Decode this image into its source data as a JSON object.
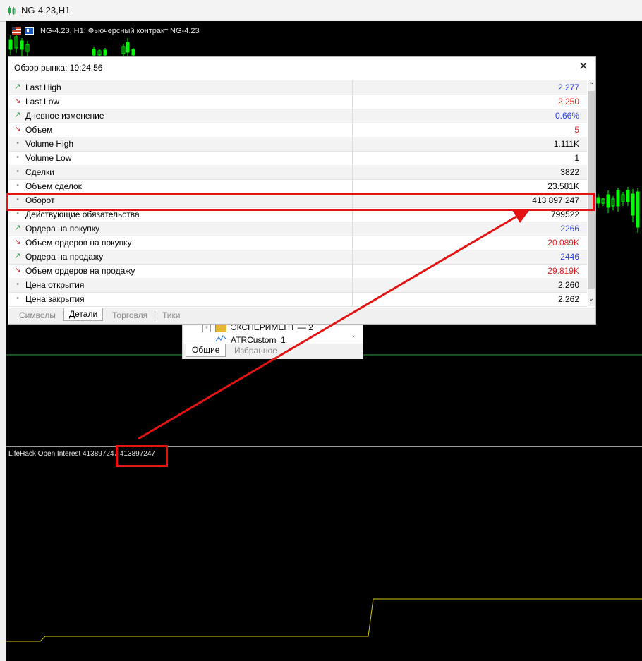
{
  "window": {
    "title": "NG-4.23,H1"
  },
  "chart": {
    "title": "NG-4.23, H1:  Фьючерсный контракт NG-4.23",
    "indicator_label": "LifeHack Open Interest  413897247 413897247",
    "colors": {
      "background": "#000000",
      "bull": "#00ff00",
      "level_line": "#2ea043",
      "indicator_line": "#d4c817",
      "highlight": "#e41313"
    }
  },
  "navigator": {
    "rows": [
      {
        "label": "ЭКСПЕРИМЕНТ — 2",
        "icon": "folder-icon"
      },
      {
        "label": "ATRCustom_1",
        "icon": "indicator-icon"
      }
    ],
    "tabs": [
      "Общие",
      "Избранное"
    ]
  },
  "market_watch": {
    "title": "Обзор рынка: 19:24:56",
    "close_label": "✕",
    "rows": [
      {
        "icon": "arrow-up-icon",
        "label": "Last High",
        "value": "2.277",
        "color": "#2b3ee0"
      },
      {
        "icon": "arrow-down-icon",
        "label": "Last Low",
        "value": "2.250",
        "color": "#e02020"
      },
      {
        "icon": "arrow-up-icon",
        "label": "Дневное изменение",
        "value": "0.66%",
        "color": "#2b3ee0"
      },
      {
        "icon": "arrow-down-icon",
        "label": "Объем",
        "value": "5",
        "color": "#e02020"
      },
      {
        "icon": "dot-icon",
        "label": "Volume High",
        "value": "1.111K",
        "color": "#000000"
      },
      {
        "icon": "dot-icon",
        "label": "Volume Low",
        "value": "1",
        "color": "#000000"
      },
      {
        "icon": "dot-icon",
        "label": "Сделки",
        "value": "3822",
        "color": "#000000"
      },
      {
        "icon": "dot-icon",
        "label": "Объем сделок",
        "value": "23.581K",
        "color": "#000000"
      },
      {
        "icon": "dot-icon",
        "label": "Оборот",
        "value": "413 897 247",
        "color": "#000000"
      },
      {
        "icon": "dot-icon",
        "label": "Действующие обязательства",
        "value": "799522",
        "color": "#000000"
      },
      {
        "icon": "arrow-up-icon",
        "label": "Ордера на покупку",
        "value": "2266",
        "color": "#2b3ee0"
      },
      {
        "icon": "arrow-down-icon",
        "label": "Объем ордеров на покупку",
        "value": "20.089K",
        "color": "#e02020"
      },
      {
        "icon": "arrow-up-icon",
        "label": "Ордера на продажу",
        "value": "2446",
        "color": "#2b3ee0"
      },
      {
        "icon": "arrow-down-icon",
        "label": "Объем ордеров на продажу",
        "value": "29.819K",
        "color": "#e02020"
      },
      {
        "icon": "dot-icon",
        "label": "Цена открытия",
        "value": "2.260",
        "color": "#000000"
      },
      {
        "icon": "dot-icon",
        "label": "Цена закрытия",
        "value": "2.262",
        "color": "#000000"
      }
    ],
    "tabs": [
      "Символы",
      "Детали",
      "Торговля",
      "Тики"
    ],
    "active_tab": "Детали"
  }
}
